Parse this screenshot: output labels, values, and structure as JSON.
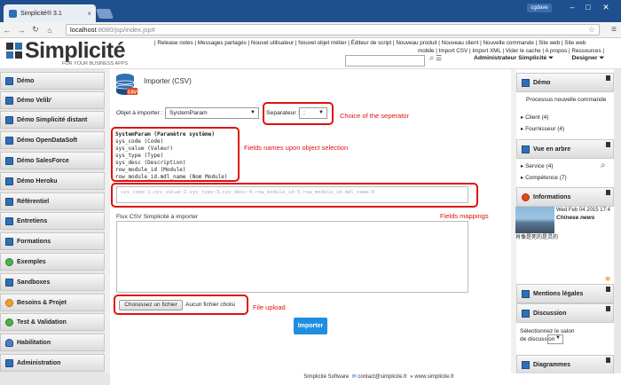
{
  "browser": {
    "tab_title": "Simplicité® 3.1",
    "user_badge": "cgdave",
    "url_host": "localhost",
    "url_path": ":8080/jsp/index.jsp#"
  },
  "header": {
    "brand": "Simplicité",
    "tagline": "FOR YOUR BUSINESS APPS",
    "links_line1": "| Release notes | Messages partagés | Nouvel utilisateur | Nouvel objet métier | Éditeur de script | Nouveau produit | Nouveau client | Nouvelle commande | Site web | Site web",
    "links_line2": "mobile | Import CSV | Import XML | Vider le cache | A propos | Ressources |",
    "admin_label": "Administrateur Simplicité",
    "designer_label": "Designer"
  },
  "sidebar": {
    "items": [
      {
        "label": "Démo",
        "icon": "folder-icon"
      },
      {
        "label": "Démo Velib'",
        "icon": "folder-icon"
      },
      {
        "label": "Démo Simplicité distant",
        "icon": "folder-icon"
      },
      {
        "label": "Démo OpenDataSoft",
        "icon": "folder-icon"
      },
      {
        "label": "Démo SalesForce",
        "icon": "folder-icon"
      },
      {
        "label": "Démo Heroku",
        "icon": "folder-icon"
      },
      {
        "label": "Référentiel",
        "icon": "folder-icon"
      },
      {
        "label": "Entretiens",
        "icon": "folder-icon"
      },
      {
        "label": "Formations",
        "icon": "folder-icon"
      },
      {
        "label": "Exemples",
        "icon": "flask-icon"
      },
      {
        "label": "Sandboxes",
        "icon": "folder-icon"
      },
      {
        "label": "Besoins & Projet",
        "icon": "gear-icon"
      },
      {
        "label": "Test & Validation",
        "icon": "check-icon"
      },
      {
        "label": "Habilitation",
        "icon": "user-icon"
      },
      {
        "label": "Administration",
        "icon": "folder-icon"
      }
    ]
  },
  "main": {
    "title": "Importer (CSV)",
    "object_label": "Objet à importer :",
    "object_value": "SystemParam",
    "separator_label": "Separateur :",
    "separator_value": ";",
    "fields_header": "SystemParam (Paramètre système)",
    "fields": [
      "sys_code (Code)",
      "sys_value (Valeur)",
      "sys_type (Type)",
      "sys_desc (Description)",
      "row_module_id (Module)",
      "row_module_id.mdl_name (Nom Module)"
    ],
    "mapping_placeholder": "sys_code:1,sys_value:2,sys_type:3,sys_desc:4,row_module_id:5,row_module_id.mdl_name:6",
    "flux_label": "Flux CSV Simplicité à importer",
    "file_button": "Choisissez un fichier",
    "file_status": "Aucun fichier choisi",
    "import_button": "Importer"
  },
  "annotations": {
    "separator": "Choice of the seperator",
    "fields": "Fields names upon object selection",
    "mappings": "Fields mappings",
    "upload": "File upload"
  },
  "right": {
    "demo_title": "Démo",
    "demo_items": [
      "Processus nouvelle commande",
      "Client (4)",
      "Fournisseur (4)"
    ],
    "tree_title": "Vue en arbre",
    "tree_items": [
      "Service (4)",
      "Compétence (7)"
    ],
    "info_title": "Informations",
    "news_date": "Wed Feb 04 2015 17:4",
    "news_source": "Chinese news",
    "news_caption": "肖像是死的是灵的",
    "legal_title": "Mentions légales",
    "discussion_title": "Discussion",
    "discussion_text": "Sélectionnez le salon de discussion",
    "diagrams_title": "Diagrammes"
  },
  "footer": {
    "company": "Simplicité Software",
    "email": "contact@simplicite.fr",
    "site": "www.simplicite.fr"
  },
  "colors": {
    "annotation": "#e01010",
    "brand_blue": "#2f6fb3",
    "import_button": "#1f8de0"
  }
}
